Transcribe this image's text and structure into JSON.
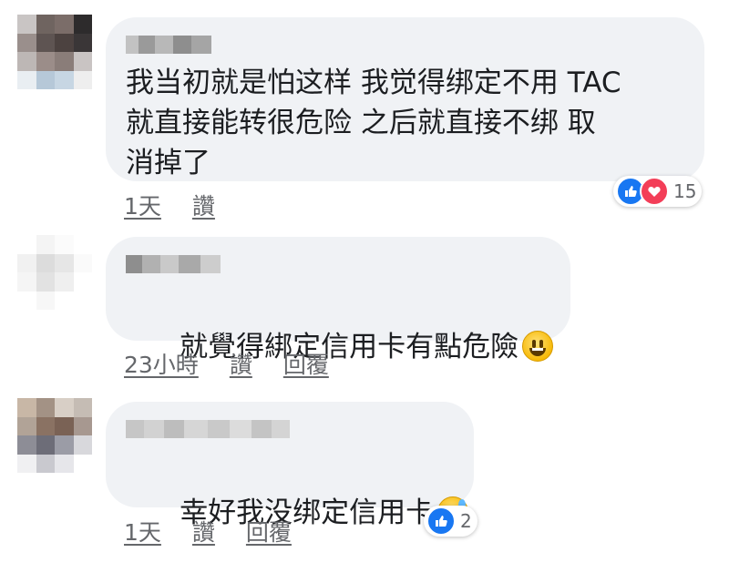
{
  "comments": [
    {
      "text": "我当初就是怕这样 我觉得绑定不用 TAC\n就直接能转很危险 之后就直接不绑 取\n消掉了",
      "emoji": "",
      "actions": {
        "time": "1天",
        "like": "讚"
      },
      "reactions": {
        "types": [
          "like-icon",
          "love-icon"
        ],
        "count": "15"
      }
    },
    {
      "text": "就覺得綁定信用卡有點危險",
      "emoji": "smiling-face-icon",
      "actions": {
        "time": "23小時",
        "like": "讚",
        "reply": "回覆"
      },
      "reactions": null
    },
    {
      "text": "幸好我没绑定信用卡",
      "emoji": "grinning-sweat-icon",
      "actions": {
        "time": "1天",
        "like": "讚",
        "reply": "回覆"
      },
      "reactions": {
        "types": [
          "like-icon"
        ],
        "count": "2"
      }
    }
  ],
  "colors": {
    "bubble": "#f0f2f5",
    "like": "#1877f2",
    "love": "#f33e58",
    "secondary_text": "#65676b"
  }
}
